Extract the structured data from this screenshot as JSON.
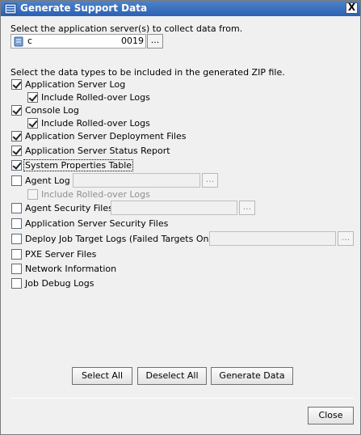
{
  "window": {
    "title": "Generate Support Data",
    "close_glyph": "X"
  },
  "servers": {
    "prompt": "Select the application server(s) to collect data from.",
    "value_prefix": "c",
    "value_suffix": "0019",
    "browse_label": "..."
  },
  "types_prompt": "Select the data types to be included in the generated ZIP file.",
  "options": {
    "app_server_log": {
      "label": "Application Server Log",
      "checked": true
    },
    "app_server_log_rolled": {
      "label": "Include Rolled-over Logs",
      "checked": true
    },
    "console_log": {
      "label": "Console Log",
      "checked": true
    },
    "console_log_rolled": {
      "label": "Include Rolled-over Logs",
      "checked": true
    },
    "deployment_files": {
      "label": "Application Server Deployment Files",
      "checked": true
    },
    "status_report": {
      "label": "Application Server Status Report",
      "checked": true
    },
    "system_properties": {
      "label": "System Properties Table",
      "checked": true
    },
    "agent_log": {
      "label": "Agent Log",
      "checked": false,
      "browse_label": "..."
    },
    "agent_log_rolled": {
      "label": "Include Rolled-over Logs",
      "checked": false
    },
    "agent_security": {
      "label": "Agent Security Files",
      "checked": false,
      "browse_label": "..."
    },
    "app_security": {
      "label": "Application Server Security Files",
      "checked": false
    },
    "deploy_job_logs": {
      "label": "Deploy Job Target Logs (Failed Targets Only)",
      "checked": false,
      "browse_label": "..."
    },
    "pxe_files": {
      "label": "PXE Server Files",
      "checked": false
    },
    "network_info": {
      "label": "Network Information",
      "checked": false
    },
    "job_debug": {
      "label": "Job Debug Logs",
      "checked": false
    }
  },
  "buttons": {
    "select_all": "Select All",
    "deselect_all": "Deselect All",
    "generate": "Generate Data",
    "close": "Close"
  },
  "colors": {
    "titlebar": "#2b60b4",
    "dialog_bg": "#f0f0f0"
  }
}
